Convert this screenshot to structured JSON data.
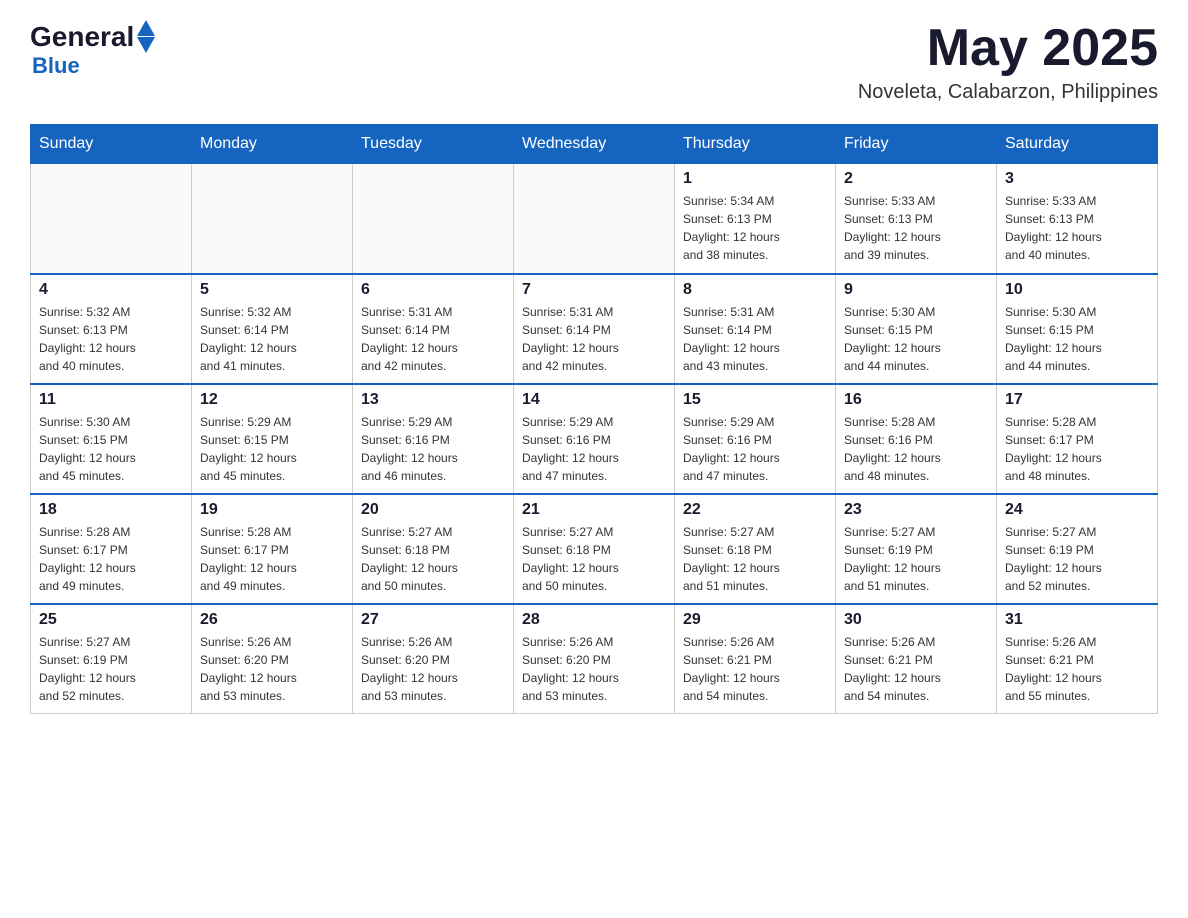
{
  "header": {
    "logo_general": "General",
    "logo_blue": "Blue",
    "month_year": "May 2025",
    "location": "Noveleta, Calabarzon, Philippines"
  },
  "days_of_week": [
    "Sunday",
    "Monday",
    "Tuesday",
    "Wednesday",
    "Thursday",
    "Friday",
    "Saturday"
  ],
  "weeks": [
    [
      {
        "day": "",
        "info": ""
      },
      {
        "day": "",
        "info": ""
      },
      {
        "day": "",
        "info": ""
      },
      {
        "day": "",
        "info": ""
      },
      {
        "day": "1",
        "info": "Sunrise: 5:34 AM\nSunset: 6:13 PM\nDaylight: 12 hours\nand 38 minutes."
      },
      {
        "day": "2",
        "info": "Sunrise: 5:33 AM\nSunset: 6:13 PM\nDaylight: 12 hours\nand 39 minutes."
      },
      {
        "day": "3",
        "info": "Sunrise: 5:33 AM\nSunset: 6:13 PM\nDaylight: 12 hours\nand 40 minutes."
      }
    ],
    [
      {
        "day": "4",
        "info": "Sunrise: 5:32 AM\nSunset: 6:13 PM\nDaylight: 12 hours\nand 40 minutes."
      },
      {
        "day": "5",
        "info": "Sunrise: 5:32 AM\nSunset: 6:14 PM\nDaylight: 12 hours\nand 41 minutes."
      },
      {
        "day": "6",
        "info": "Sunrise: 5:31 AM\nSunset: 6:14 PM\nDaylight: 12 hours\nand 42 minutes."
      },
      {
        "day": "7",
        "info": "Sunrise: 5:31 AM\nSunset: 6:14 PM\nDaylight: 12 hours\nand 42 minutes."
      },
      {
        "day": "8",
        "info": "Sunrise: 5:31 AM\nSunset: 6:14 PM\nDaylight: 12 hours\nand 43 minutes."
      },
      {
        "day": "9",
        "info": "Sunrise: 5:30 AM\nSunset: 6:15 PM\nDaylight: 12 hours\nand 44 minutes."
      },
      {
        "day": "10",
        "info": "Sunrise: 5:30 AM\nSunset: 6:15 PM\nDaylight: 12 hours\nand 44 minutes."
      }
    ],
    [
      {
        "day": "11",
        "info": "Sunrise: 5:30 AM\nSunset: 6:15 PM\nDaylight: 12 hours\nand 45 minutes."
      },
      {
        "day": "12",
        "info": "Sunrise: 5:29 AM\nSunset: 6:15 PM\nDaylight: 12 hours\nand 45 minutes."
      },
      {
        "day": "13",
        "info": "Sunrise: 5:29 AM\nSunset: 6:16 PM\nDaylight: 12 hours\nand 46 minutes."
      },
      {
        "day": "14",
        "info": "Sunrise: 5:29 AM\nSunset: 6:16 PM\nDaylight: 12 hours\nand 47 minutes."
      },
      {
        "day": "15",
        "info": "Sunrise: 5:29 AM\nSunset: 6:16 PM\nDaylight: 12 hours\nand 47 minutes."
      },
      {
        "day": "16",
        "info": "Sunrise: 5:28 AM\nSunset: 6:16 PM\nDaylight: 12 hours\nand 48 minutes."
      },
      {
        "day": "17",
        "info": "Sunrise: 5:28 AM\nSunset: 6:17 PM\nDaylight: 12 hours\nand 48 minutes."
      }
    ],
    [
      {
        "day": "18",
        "info": "Sunrise: 5:28 AM\nSunset: 6:17 PM\nDaylight: 12 hours\nand 49 minutes."
      },
      {
        "day": "19",
        "info": "Sunrise: 5:28 AM\nSunset: 6:17 PM\nDaylight: 12 hours\nand 49 minutes."
      },
      {
        "day": "20",
        "info": "Sunrise: 5:27 AM\nSunset: 6:18 PM\nDaylight: 12 hours\nand 50 minutes."
      },
      {
        "day": "21",
        "info": "Sunrise: 5:27 AM\nSunset: 6:18 PM\nDaylight: 12 hours\nand 50 minutes."
      },
      {
        "day": "22",
        "info": "Sunrise: 5:27 AM\nSunset: 6:18 PM\nDaylight: 12 hours\nand 51 minutes."
      },
      {
        "day": "23",
        "info": "Sunrise: 5:27 AM\nSunset: 6:19 PM\nDaylight: 12 hours\nand 51 minutes."
      },
      {
        "day": "24",
        "info": "Sunrise: 5:27 AM\nSunset: 6:19 PM\nDaylight: 12 hours\nand 52 minutes."
      }
    ],
    [
      {
        "day": "25",
        "info": "Sunrise: 5:27 AM\nSunset: 6:19 PM\nDaylight: 12 hours\nand 52 minutes."
      },
      {
        "day": "26",
        "info": "Sunrise: 5:26 AM\nSunset: 6:20 PM\nDaylight: 12 hours\nand 53 minutes."
      },
      {
        "day": "27",
        "info": "Sunrise: 5:26 AM\nSunset: 6:20 PM\nDaylight: 12 hours\nand 53 minutes."
      },
      {
        "day": "28",
        "info": "Sunrise: 5:26 AM\nSunset: 6:20 PM\nDaylight: 12 hours\nand 53 minutes."
      },
      {
        "day": "29",
        "info": "Sunrise: 5:26 AM\nSunset: 6:21 PM\nDaylight: 12 hours\nand 54 minutes."
      },
      {
        "day": "30",
        "info": "Sunrise: 5:26 AM\nSunset: 6:21 PM\nDaylight: 12 hours\nand 54 minutes."
      },
      {
        "day": "31",
        "info": "Sunrise: 5:26 AM\nSunset: 6:21 PM\nDaylight: 12 hours\nand 55 minutes."
      }
    ]
  ]
}
